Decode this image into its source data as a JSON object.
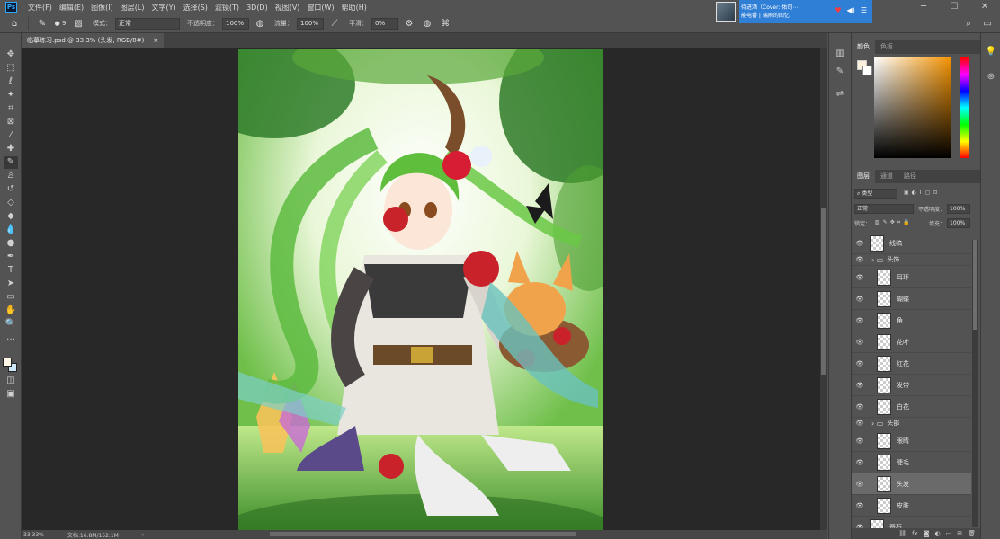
{
  "menubar": {
    "app_logo": "Ps",
    "items": [
      "文件(F)",
      "编辑(E)",
      "图像(I)",
      "图层(L)",
      "文字(Y)",
      "选择(S)",
      "滤镜(T)",
      "3D(D)",
      "视图(V)",
      "窗口(W)",
      "帮助(H)"
    ]
  },
  "optionsbar": {
    "brush_size": "9",
    "mode_label": "模式：",
    "mode_value": "正常",
    "opacity_label": "不透明度：",
    "opacity_value": "100%",
    "flow_label": "流量：",
    "flow_value": "100%",
    "smoothing_label": "平滑：",
    "smoothing_value": "0%"
  },
  "notification": {
    "line1": "待进酒（Cover: 佑司⋯",
    "line2": "能电番 | 瑞雨的回忆",
    "accent": "#2f7fd6"
  },
  "document": {
    "tab_title": "临摹练习.psd @ 33.3% (头发, RGB/8#)",
    "close_glyph": "×"
  },
  "statusbar": {
    "zoom": "33.33%",
    "doc_size": "文档:16.8M/152.1M",
    "arrow": "›"
  },
  "color_panel": {
    "tabs": [
      "颜色",
      "色板"
    ],
    "foreground": "#fbf0de",
    "background": "#ffffff"
  },
  "layers_panel": {
    "tabs": [
      "图层",
      "通道",
      "路径"
    ],
    "filter_value": "类型",
    "blend_mode": "正常",
    "opacity_label": "不透明度：",
    "opacity_value": "100%",
    "lock_label": "锁定：",
    "fill_label": "填充：",
    "fill_value": "100%",
    "layers": [
      {
        "name": "线稿",
        "type": "layer",
        "indent": 0
      },
      {
        "name": "头饰",
        "type": "group",
        "indent": 0
      },
      {
        "name": "耳环",
        "type": "layer",
        "indent": 1
      },
      {
        "name": "蝴蝶",
        "type": "layer",
        "indent": 1
      },
      {
        "name": "角",
        "type": "layer",
        "indent": 1
      },
      {
        "name": "花叶",
        "type": "layer",
        "indent": 1
      },
      {
        "name": "红花",
        "type": "layer",
        "indent": 1
      },
      {
        "name": "发带",
        "type": "layer",
        "indent": 1
      },
      {
        "name": "白花",
        "type": "layer",
        "indent": 1
      },
      {
        "name": "头部",
        "type": "group",
        "indent": 0
      },
      {
        "name": "眼睛",
        "type": "layer",
        "indent": 1
      },
      {
        "name": "睫毛",
        "type": "layer",
        "indent": 1
      },
      {
        "name": "头发",
        "type": "layer",
        "indent": 1,
        "selected": true
      },
      {
        "name": "皮肤",
        "type": "layer",
        "indent": 1
      },
      {
        "name": "基石",
        "type": "layer",
        "indent": 0
      }
    ],
    "bottom_icons": [
      "link-icon",
      "fx-icon",
      "mask-icon",
      "adjustment-icon",
      "folder-icon",
      "new-layer-icon",
      "trash-icon"
    ]
  }
}
